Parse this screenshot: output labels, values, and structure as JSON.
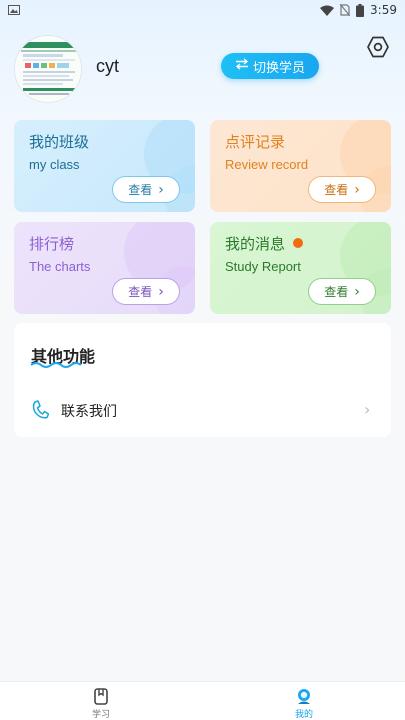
{
  "status_bar": {
    "time": "3:59",
    "icons": [
      "image-icon",
      "wifi-icon",
      "no-sim-icon",
      "battery-icon"
    ]
  },
  "header": {
    "username": "cyt",
    "switch_button": "切换学员",
    "settings_icon": "gear-icon"
  },
  "cards": {
    "my_class": {
      "title": "我的班级",
      "subtitle": "my class",
      "button": "查看"
    },
    "review_record": {
      "title": "点评记录",
      "subtitle": "Review record",
      "button": "查看"
    },
    "charts": {
      "title": "排行榜",
      "subtitle": "The charts",
      "button": "查看"
    },
    "messages": {
      "title": "我的消息",
      "subtitle": "Study Report",
      "button": "查看"
    }
  },
  "other_functions": {
    "title": "其他功能",
    "items": [
      {
        "label": "联系我们",
        "icon": "phone-icon"
      }
    ]
  },
  "bottom_nav": {
    "items": [
      {
        "label": "学习",
        "icon": "book-icon",
        "active": false
      },
      {
        "label": "我的",
        "icon": "profile-icon",
        "active": true
      }
    ]
  },
  "colors": {
    "accent": "#1aa6f0",
    "badge": "#f26b0f"
  }
}
